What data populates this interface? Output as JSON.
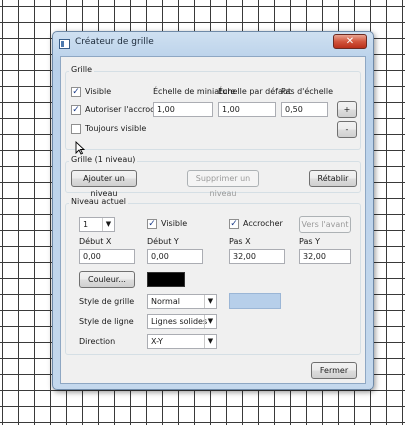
{
  "window": {
    "title": "Créateur de grille",
    "close_glyph": "✕"
  },
  "grid_section": {
    "label": "Grille",
    "visible": {
      "label": "Visible",
      "checked": true
    },
    "snap": {
      "label": "Autoriser l'accrochage",
      "checked": true
    },
    "always_visible": {
      "label": "Toujours visible",
      "checked": false
    },
    "thumb_scale": {
      "label": "Échelle de miniature",
      "value": "1,00"
    },
    "default_scale": {
      "label": "Échelle par défaut",
      "value": "1,00"
    },
    "scale_step": {
      "label": "Pas d'échelle",
      "value": "0,50"
    },
    "plus_label": "+",
    "minus_label": "-"
  },
  "levels_section": {
    "label": "Grille (1 niveau)",
    "add_label": "Ajouter un niveau",
    "remove_label": "Supprimer un niveau",
    "reset_label": "Rétablir"
  },
  "current_level": {
    "label": "Niveau actuel",
    "level_value": "1",
    "visible": {
      "label": "Visible",
      "checked": true
    },
    "snap": {
      "label": "Accrocher",
      "checked": true
    },
    "forward_label": "Vers l'avant",
    "start_x": {
      "label": "Début X",
      "value": "0,00"
    },
    "start_y": {
      "label": "Début Y",
      "value": "0,00"
    },
    "step_x": {
      "label": "Pas X",
      "value": "32,00"
    },
    "step_y": {
      "label": "Pas Y",
      "value": "32,00"
    },
    "color_label": "Couleur...",
    "grid_color": "#000000",
    "grid_style": {
      "label": "Style de grille",
      "value": "Normal"
    },
    "style_preview_color": "#b7cfea",
    "line_style": {
      "label": "Style de ligne",
      "value": "Lignes solides"
    },
    "direction": {
      "label": "Direction",
      "value": "X-Y"
    }
  },
  "footer": {
    "close_label": "Fermer"
  },
  "icons": {
    "check": "✓",
    "dropdown": "▼",
    "cursor": "cursor-arrow-icon"
  }
}
